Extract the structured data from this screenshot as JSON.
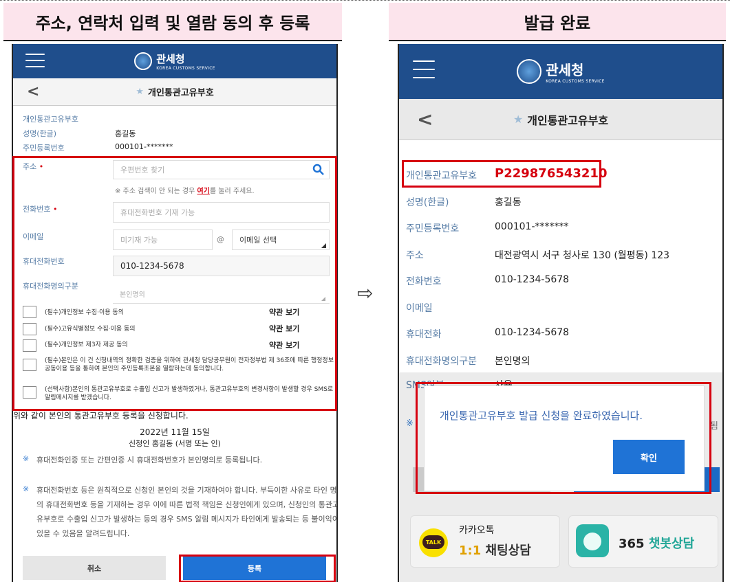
{
  "left_panel": {
    "header": "주소, 연락처 입력 및 열람 동의 후 등록",
    "app_title": "관세청",
    "app_subtitle": "KOREA CUSTOMS SERVICE",
    "back": "<",
    "star": "★",
    "page_title": "개인통관고유부호",
    "section": "개인통관고유부호",
    "name_label": "성명(한글)",
    "name_value": "홍길동",
    "rrn_label": "주민등록번호",
    "rrn_value": "000101-*******",
    "address_label": "주소",
    "required_mark": "•",
    "postcode_placeholder": "우편번호 찾기",
    "address_hint_prefix": "※ 주소 검색이 안 되는 경우",
    "address_hint_link": "여기",
    "address_hint_suffix": "를 눌러 주세요.",
    "phone_label": "전화번호",
    "phone_placeholder": "휴대전화번호 기재 가능",
    "email_label": "이메일",
    "email_placeholder": "미기재 가능",
    "email_at": "@",
    "email_select": "이메일 선택",
    "mobile_label": "휴대전화번호",
    "mobile_value": "010-1234-5678",
    "mobile_owner_label": "휴대전화명의구분",
    "mobile_owner_value": "본인명의",
    "agreements": [
      {
        "text": "(필수)개인정보 수집·이용 동의",
        "link": "약관 보기"
      },
      {
        "text": "(필수)고유식별정보 수집·이용 동의",
        "link": "약관 보기"
      },
      {
        "text": "(필수)개인정보 제3자 제공 동의",
        "link": "약관 보기"
      }
    ],
    "consent_long": "(필수)본인은 이 건 신청내역의 정확한 검증을 위하여 관세청 담당공무원이 전자정부법 제 36조에 따른 행정정보 공동이용 등을 통하여 본인의 주민등록초본을 열람하는데 동의합니다.",
    "consent_sms": "(선택사항)본인의 통관고유부호로 수출입 신고가 발생하였거나, 통관고유부호의 변경사항이 발생할 경우 SMS로 알림메시지를 받겠습니다.",
    "apply_text": "위와 같이 본인의 통관고유부호 등록을 신청합니다.",
    "date": "2022년 11월 15일",
    "signature": "신청인 홍길동 (서명 또는 인)",
    "note_mark": "※",
    "note1": "휴대전화인증 또는 간편인증 시 휴대전화번호가 본인명의로 등록됩니다.",
    "note2": "휴대전화번호 등은 원칙적으로 신청인 본인의 것을 기재하여야 합니다. 부득이한 사유로 타인 명의의 휴대전화번호 등을 기재하는 경우 이에 따른 법적 책임은 신청인에게 있으며, 신청인의 통관고유부호로 수출입 신고가 발생하는 등의 경우 SMS 알림 메시지가 타인에게 발송되는 등 불이익이 있을 수 있음을 알려드립니다.",
    "cancel": "취소",
    "register": "등록"
  },
  "arrow": "⇨",
  "right_panel": {
    "header": "발급 완료",
    "app_title": "관세청",
    "app_subtitle": "KOREA CUSTOMS SERVICE",
    "back": "<",
    "star": "★",
    "page_title": "개인통관고유부호",
    "code_label": "개인통관고유부호",
    "code_value": "P229876543210",
    "name_label": "성명(한글)",
    "name_value": "홍길동",
    "rrn_label": "주민등록번호",
    "rrn_value": "000101-*******",
    "address_label": "주소",
    "address_value": "대전광역시 서구 청사로 130 (월평동) 123",
    "phone_label": "전화번호",
    "phone_value": "010-1234-5678",
    "email_label": "이메일",
    "mobile_label": "휴대전화",
    "mobile_value": "010-1234-5678",
    "mobile_owner_label": "휴대전화명의구분",
    "mobile_owner_value": "본인명의",
    "sms_label": "SMS여부",
    "sms_value": "사용",
    "note_mark": "※",
    "note_tail": "됨",
    "modal_message": "개인통관고유부호 발급 신청을 완료하였습니다.",
    "modal_confirm": "확인",
    "kakao_badge": "TALK",
    "kakao_title": "카카오톡",
    "kakao_sub_prefix": "1:1",
    "kakao_sub": "채팅상담",
    "chatbot_number": "365",
    "chatbot_text": "챗봇상담"
  },
  "colors": {
    "navy": "#1f4e8c",
    "red": "#d6000f",
    "blue_btn": "#1f73d6",
    "header_bg": "#fce4ec"
  }
}
